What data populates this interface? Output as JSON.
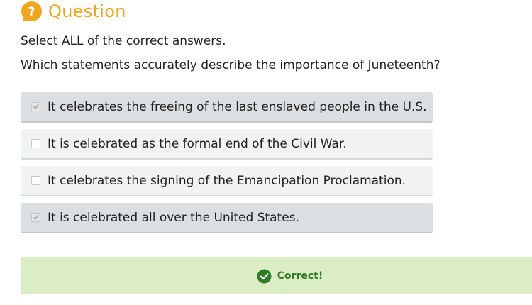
{
  "header": {
    "icon": "question-mark-icon",
    "title": "Question",
    "accent_color": "#f0a51f"
  },
  "instruction": "Select ALL of the correct answers.",
  "prompt": "Which statements accurately describe the importance of Juneteenth?",
  "options": [
    {
      "label": "It celebrates the freeing of the last enslaved people in the U.S.",
      "checked": true
    },
    {
      "label": "It is celebrated as the formal end of the Civil War.",
      "checked": false
    },
    {
      "label": "It celebrates the signing of the Emancipation Proclamation.",
      "checked": false
    },
    {
      "label": "It is celebrated all over the United States.",
      "checked": true
    }
  ],
  "feedback": {
    "icon": "check-circle-icon",
    "text": "Correct!",
    "background_color": "#dbedc4",
    "text_color": "#2e7d25"
  }
}
